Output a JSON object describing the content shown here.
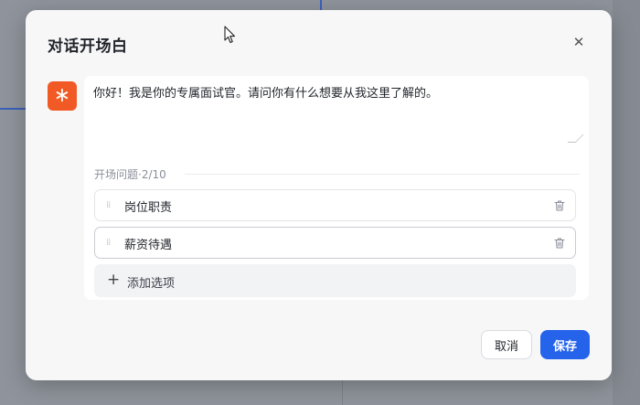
{
  "modal": {
    "title": "对话开场白",
    "close_icon": "close-icon"
  },
  "avatar": {
    "icon": "asterisk-icon",
    "glyph": "∗",
    "color": "#f15a24"
  },
  "greeting": {
    "value": "你好！我是你的专属面试官。请问你有什么想要从我这里了解的。"
  },
  "questions": {
    "section_label": "开场问题·2/10",
    "items": [
      {
        "value": "岗位职责"
      },
      {
        "value": "薪资待遇"
      }
    ],
    "add_label": "添加选项"
  },
  "footer": {
    "cancel_label": "取消",
    "save_label": "保存",
    "accent": "#2563eb"
  }
}
